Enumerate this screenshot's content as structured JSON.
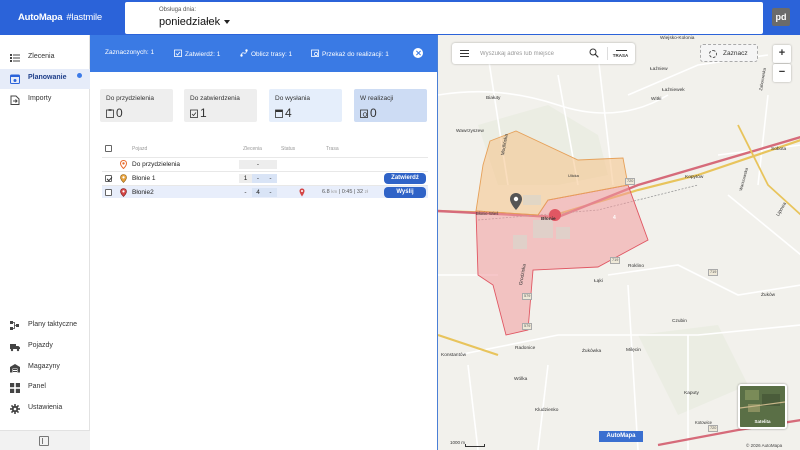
{
  "topbar": {
    "brand": "AutoMapa",
    "brand_tag": "#lastmile",
    "day_label": "Obsługa dnia:",
    "day_value": "poniedziałek",
    "avatar": "pd"
  },
  "nav": {
    "items": [
      {
        "label": "Zlecenia",
        "icon": "list-icon"
      },
      {
        "label": "Planowanie",
        "icon": "planning-icon",
        "active": true
      },
      {
        "label": "Importy",
        "icon": "import-icon"
      }
    ],
    "bottom_items": [
      {
        "label": "Plany taktyczne",
        "icon": "tactical-plan-icon"
      },
      {
        "label": "Pojazdy",
        "icon": "truck-icon"
      },
      {
        "label": "Magazyny",
        "icon": "warehouse-icon"
      },
      {
        "label": "Panel",
        "icon": "dashboard-icon"
      },
      {
        "label": "Ustawienia",
        "icon": "gear-icon"
      }
    ]
  },
  "selection_bar": {
    "selected": "Zaznaczonych: 1",
    "approve": "Zatwierdź: 1",
    "calc_routes": "Oblicz trasy: 1",
    "hand_over": "Przekaż do realizacji: 1"
  },
  "stats": [
    {
      "title": "Do przydzielenia",
      "value": "0"
    },
    {
      "title": "Do zatwierdzenia",
      "value": "1"
    },
    {
      "title": "Do wysłania",
      "value": "4"
    },
    {
      "title": "W realizacji",
      "value": "0"
    }
  ],
  "table": {
    "headers": {
      "vehicle": "Pojazd",
      "orders": "Zlecenia",
      "status": "Status",
      "route": "Trasa"
    },
    "rows": [
      {
        "name": "Do przydzielenia",
        "orders": "-",
        "pin_color": "#e8692b"
      },
      {
        "name": "Błonie 1",
        "orders_a": "1",
        "orders_b": "-",
        "orders_c": "-",
        "action": "Zatwierdź",
        "pin_color": "#e8a23b",
        "checked": true
      },
      {
        "name": "Błonie2",
        "orders_a": "-",
        "orders_b": "4",
        "orders_c": "-",
        "distance": "6.8",
        "distance_unit": "km",
        "duration": "0:45",
        "cost": "32",
        "cost_unit": "zł",
        "action": "Wyślij",
        "pin_color": "#d44646"
      }
    ]
  },
  "map": {
    "search_placeholder": "Wyszukaj adres lub miejsce",
    "route_btn": "TRASA",
    "select_btn": "Zaznacz",
    "zoom_in": "+",
    "zoom_out": "−",
    "satellite": "Satelita",
    "logo": "AutoMapa",
    "scale": "1000 m",
    "copyright": "© 2026 AutoMapa",
    "cluster_count": "4",
    "labels": {
      "wiejsko_kolonia": "Wiejsko-Kolonia",
      "lasmy_dwor": "Łaźniew",
      "witki": "Witki",
      "lazniewek": "Łaźniewek",
      "bialuty": "Białuty",
      "wawrzyszew": "Wawrzyszew",
      "moddluba": "Modlińska",
      "blonie": "Błonie",
      "blonie_wies": "Błonie-Wieś",
      "kopytow": "Kopytów",
      "grodziska": "Grodziska",
      "roklino": "Roklino",
      "laki": "Łąki",
      "czubin": "Czubin",
      "radonice": "Radonice",
      "konstantow": "Konstantów",
      "zukowka": "Żukówka",
      "milecin": "Milęcin",
      "kludzienko": "Kludzienko",
      "wolka": "Wólka",
      "kaputy": "Kaputy",
      "kotowice": "Kotowice",
      "lipowa": "Lipowa",
      "warszawska": "Warszawska",
      "zaborowska": "Zaborowska",
      "sobota": "Sobota",
      "ulicka": "Ulicka",
      "zukow": "Żuków"
    },
    "road_numbers": {
      "r1": "720",
      "r2": "719",
      "r3": "579",
      "r4": "719",
      "r5": "720",
      "r6": "579"
    }
  }
}
